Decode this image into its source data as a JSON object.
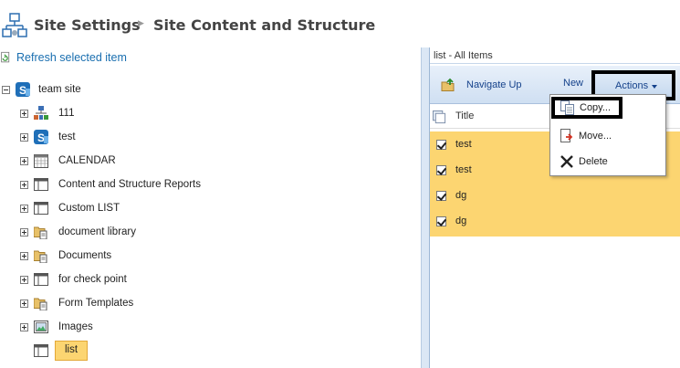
{
  "header": {
    "title": "Site Settings",
    "subtitle": "Site Content and Structure"
  },
  "left_pane": {
    "refresh_label": "Refresh selected item",
    "root": {
      "label": "team site",
      "icon": "sharepoint-site-icon"
    },
    "nodes": [
      {
        "label": "111",
        "icon": "site-hierarchy-icon"
      },
      {
        "label": "test",
        "icon": "sharepoint-site-icon"
      },
      {
        "label": "CALENDAR",
        "icon": "calendar-icon"
      },
      {
        "label": "Content and Structure Reports",
        "icon": "list-icon"
      },
      {
        "label": "Custom LIST",
        "icon": "list-icon"
      },
      {
        "label": "document library",
        "icon": "document-library-icon"
      },
      {
        "label": "Documents",
        "icon": "document-library-icon"
      },
      {
        "label": "for check point",
        "icon": "list-icon"
      },
      {
        "label": "Form Templates",
        "icon": "document-library-icon"
      },
      {
        "label": "Images",
        "icon": "picture-library-icon"
      },
      {
        "label": "list",
        "icon": "list-icon",
        "selected": true
      }
    ]
  },
  "right_pane": {
    "view_title": "list - All Items",
    "toolbar": {
      "navigate_up": "Navigate Up",
      "new": "New",
      "actions": "Actions"
    },
    "column_title": "Title",
    "rows": [
      {
        "title": "test",
        "checked": true
      },
      {
        "title": "test",
        "checked": true
      },
      {
        "title": "dg",
        "checked": true
      },
      {
        "title": "dg",
        "checked": true
      }
    ]
  },
  "actions_menu": {
    "items": [
      {
        "label": "Copy...",
        "icon": "copy-icon"
      },
      {
        "label": "Move...",
        "icon": "move-icon"
      },
      {
        "label": "Delete",
        "icon": "delete-icon"
      }
    ]
  },
  "colors": {
    "selection": "#fcd571",
    "link": "#1a6fb0",
    "toolbar_text": "#15428b",
    "splitter": "#dbe7f5"
  }
}
